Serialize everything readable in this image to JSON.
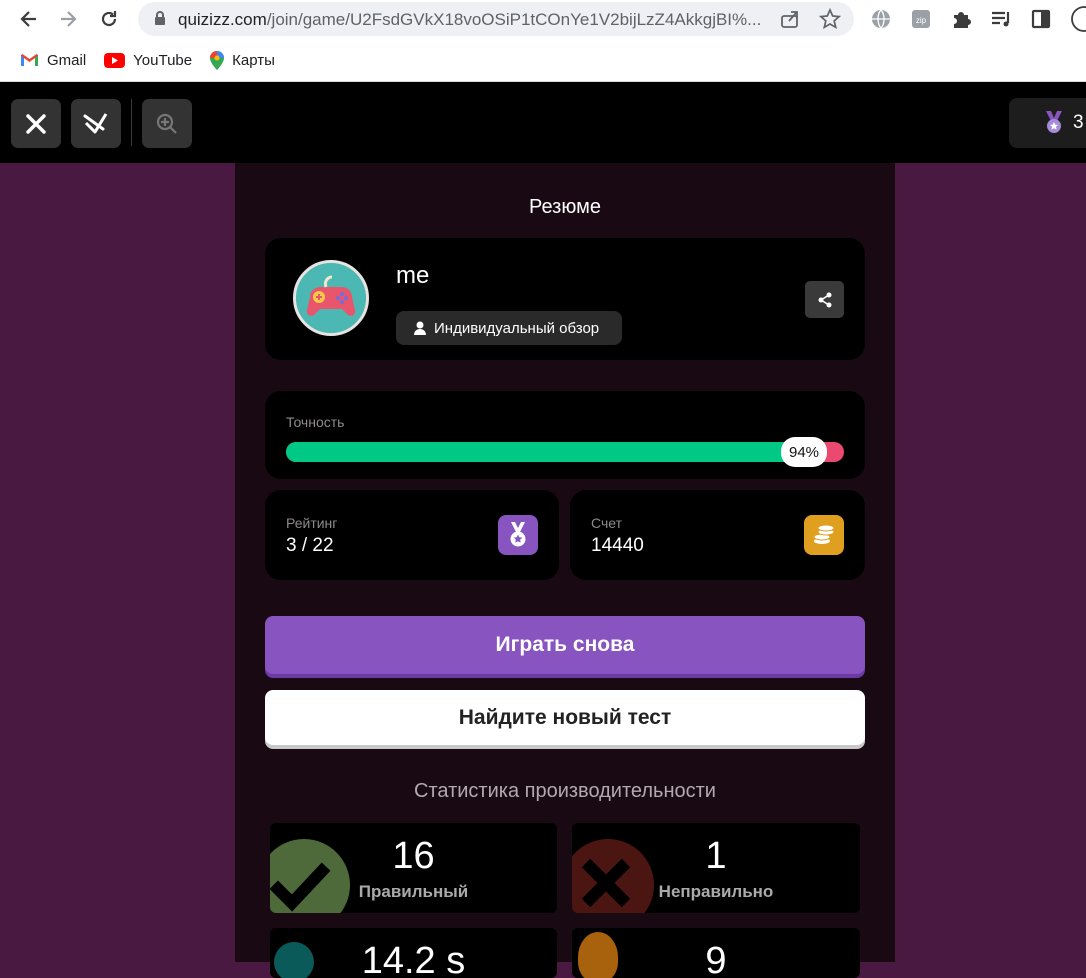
{
  "browser": {
    "url_host": "quizizz.com",
    "url_path": "/join/game/U2FsdGVkX18voOSiP1tCOnYe1V2bijLzZ4AkkgjBI%...",
    "bookmarks": [
      {
        "label": "Gmail",
        "icon": "gmail-icon"
      },
      {
        "label": "YouTube",
        "icon": "youtube-icon"
      },
      {
        "label": "Карты",
        "icon": "maps-icon"
      }
    ]
  },
  "topbar": {
    "rank_short": "3"
  },
  "summary": {
    "heading": "Резюме",
    "player_name": "me",
    "review_label": "Индивидуальный обзор"
  },
  "accuracy": {
    "label": "Точность",
    "percent_text": "94%",
    "fraction": 0.94
  },
  "rating": {
    "label": "Рейтинг",
    "value": "3 / 22"
  },
  "score": {
    "label": "Счет",
    "value": "14440"
  },
  "buttons": {
    "play_again": "Играть снова",
    "find_new": "Найдите новый тест"
  },
  "performance": {
    "heading": "Статистика производительности",
    "correct_value": "16",
    "correct_label": "Правильный",
    "incorrect_value": "1",
    "incorrect_label": "Неправильно",
    "time_value": "14.2 s",
    "streak_value": "9"
  },
  "colors": {
    "accent_purple": "#8854c0",
    "correct_green": "#00c985",
    "incorrect_red": "#ec4971",
    "bg_purple": "#4a1942"
  }
}
